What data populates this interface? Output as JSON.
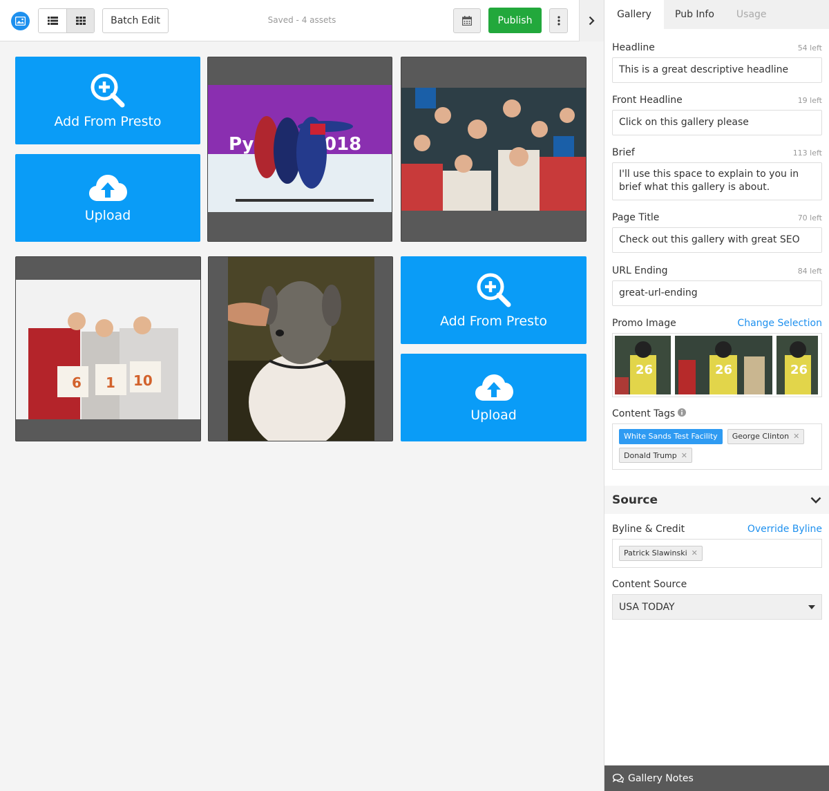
{
  "toolbar": {
    "batch_edit_label": "Batch Edit",
    "status": "Saved - 4 assets",
    "publish_label": "Publish"
  },
  "grid": {
    "add_label": "Add From Presto",
    "upload_label": "Upload",
    "photos": [
      {
        "subject": "speed skating"
      },
      {
        "subject": "ski crowd selfie"
      },
      {
        "subject": "halfpipe medalists"
      },
      {
        "subject": "whippet dog"
      }
    ]
  },
  "sidebar": {
    "tabs": [
      {
        "label": "Gallery",
        "state": "active"
      },
      {
        "label": "Pub Info",
        "state": "normal"
      },
      {
        "label": "Usage",
        "state": "disabled"
      }
    ],
    "fields": {
      "headline": {
        "label": "Headline",
        "remaining": "54 left",
        "value": "This is a great descriptive headline"
      },
      "front_headline": {
        "label": "Front Headline",
        "remaining": "19 left",
        "value": "Click on this gallery please"
      },
      "brief": {
        "label": "Brief",
        "remaining": "113 left",
        "value": "I'll use this space to explain to you in brief what this gallery is about."
      },
      "page_title": {
        "label": "Page Title",
        "remaining": "70 left",
        "value": "Check out this gallery with great SEO"
      },
      "url_ending": {
        "label": "URL Ending",
        "remaining": "84 left",
        "value": "great-url-ending"
      }
    },
    "promo": {
      "label": "Promo Image",
      "action": "Change Selection"
    },
    "content_tags": {
      "label": "Content Tags",
      "tags": [
        {
          "label": "White Sands Test Facility",
          "selected": true
        },
        {
          "label": "George Clinton",
          "selected": false
        },
        {
          "label": "Donald Trump",
          "selected": false
        }
      ]
    },
    "source": {
      "heading": "Source",
      "byline_label": "Byline & Credit",
      "byline_action": "Override Byline",
      "byline_tag": "Patrick Slawinski",
      "content_source_label": "Content Source",
      "content_source_value": "USA TODAY"
    },
    "notes_label": "Gallery Notes"
  },
  "colors": {
    "accent": "#0a9cf7",
    "publish": "#22a83c",
    "tag_selected": "#2f9bf2"
  }
}
